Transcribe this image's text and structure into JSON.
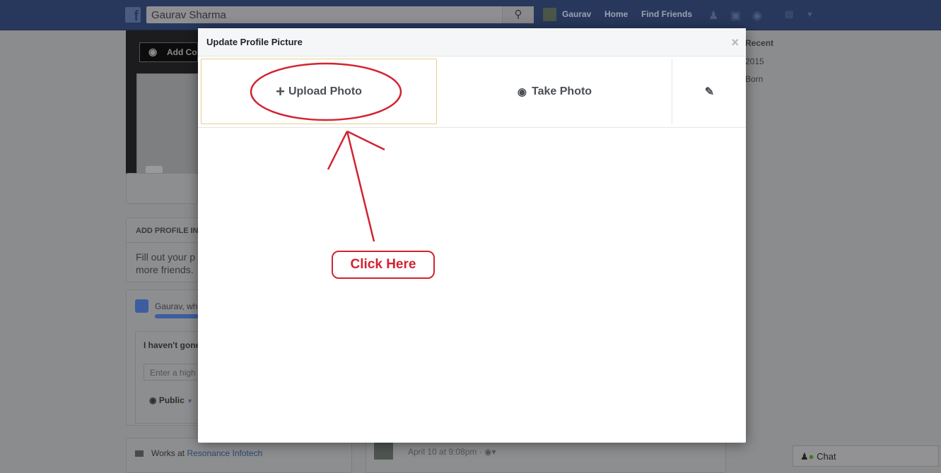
{
  "topbar": {
    "search_value": "Gaurav Sharma",
    "user": "Gaurav",
    "home": "Home",
    "find_friends": "Find Friends"
  },
  "profile": {
    "add_cover": "Add Cover"
  },
  "left": {
    "add_profile_info": "ADD PROFILE IN",
    "fill_out": "Fill out your p",
    "more_friends": "more friends.",
    "question": "Gaurav, wh",
    "high_school_title": "I haven't gone",
    "high_school_placeholder": "Enter a high",
    "privacy": "Public",
    "works_at_prefix": "Works at ",
    "works_at_company": "Resonance Infotech"
  },
  "right": {
    "recent": "Recent",
    "year": "2015",
    "born": "Born"
  },
  "post": {
    "timestamp": "April 10 at 9:08pm ·"
  },
  "chat": {
    "label": "Chat"
  },
  "modal": {
    "title": "Update Profile Picture",
    "close": "×",
    "upload": "Upload Photo",
    "take": "Take Photo"
  },
  "annotation": {
    "label": "Click Here",
    "color": "#d32330"
  }
}
